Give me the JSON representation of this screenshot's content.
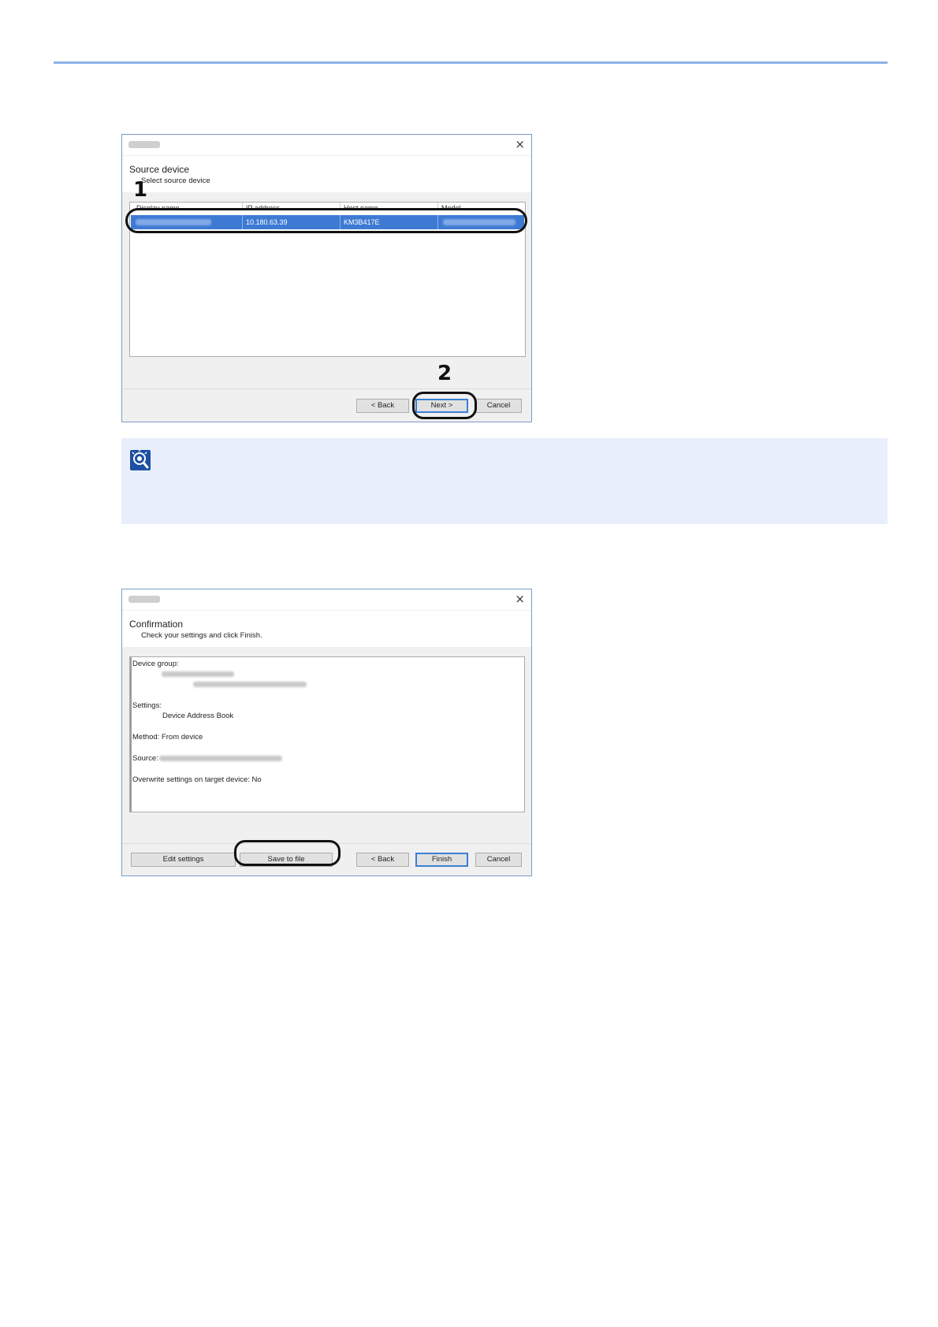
{
  "source_dialog": {
    "heading": "Source device",
    "subheading": "Select source device",
    "close_glyph": "×",
    "columns": [
      "Display name",
      "IP address",
      "Host name",
      "Model"
    ],
    "row": {
      "ip_address": "10.180.63.39",
      "host_name": "KM3B417E"
    },
    "buttons": {
      "back": "< Back",
      "next": "Next >",
      "cancel": "Cancel"
    },
    "callouts": [
      "1",
      "2"
    ]
  },
  "note": {
    "icon": "lightbulb-note-icon"
  },
  "confirmation_dialog": {
    "heading": "Confirmation",
    "subheading": "Check your settings and click Finish.",
    "close_glyph": "×",
    "details": {
      "device_group_label": "Device group:",
      "settings_label": "Settings:",
      "settings_value": "Device Address Book",
      "method": "Method: From device",
      "source_label": "Source:",
      "overwrite": "Overwrite settings on target device: No"
    },
    "buttons": {
      "edit": "Edit settings",
      "save": "Save to file",
      "back": "< Back",
      "finish": "Finish",
      "cancel": "Cancel"
    }
  },
  "colors": {
    "accent_rule": "#8db3e8",
    "selection": "#3d7ad4",
    "note_background": "#e8eefb"
  }
}
